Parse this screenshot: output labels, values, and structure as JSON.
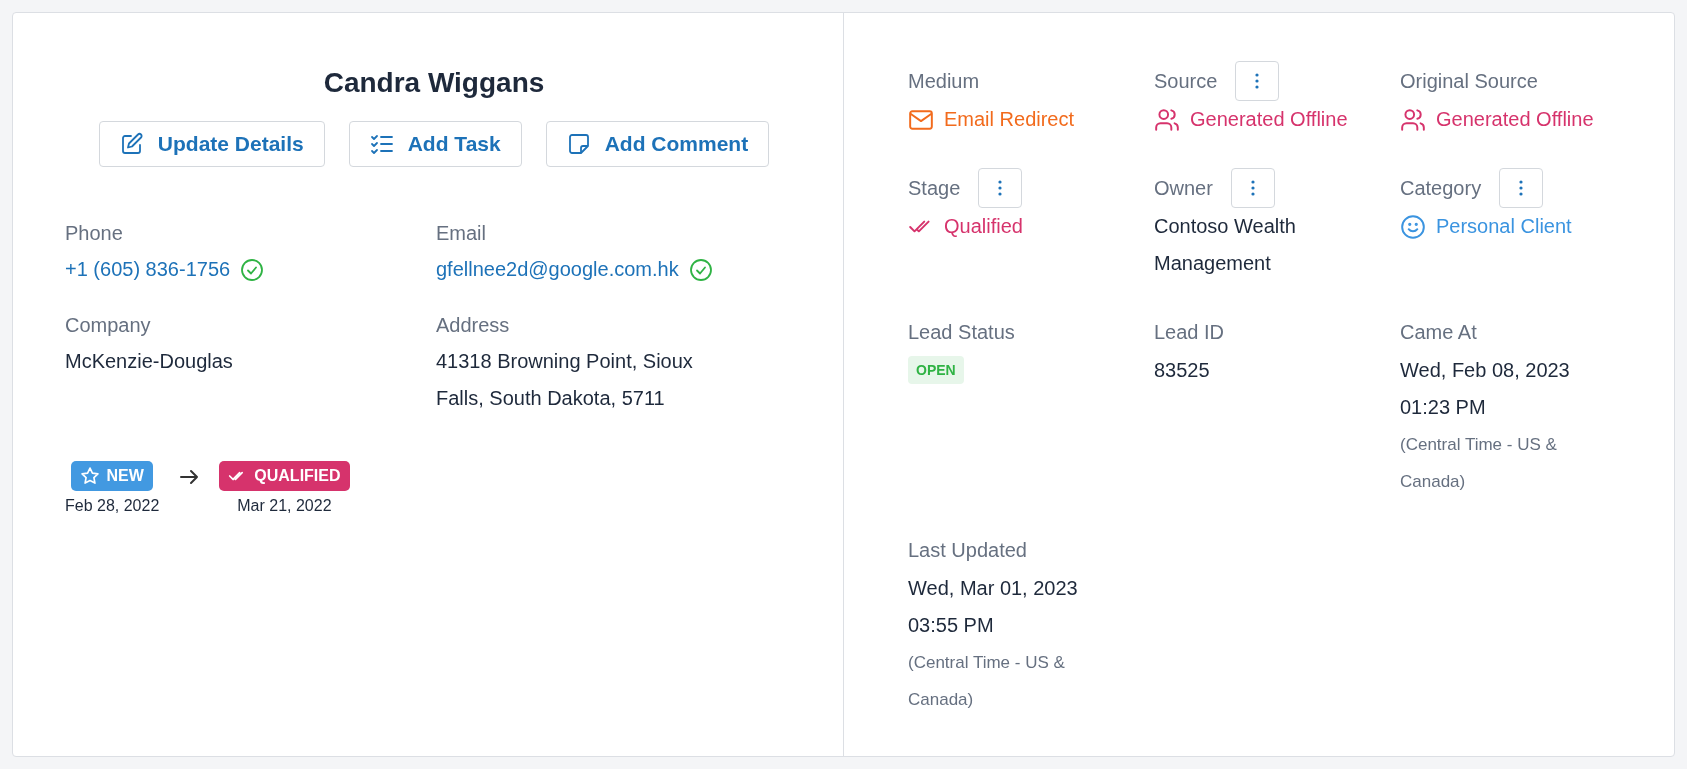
{
  "name": "Candra Wiggans",
  "actions": [
    {
      "label": "Update Details",
      "kind": "edit"
    },
    {
      "label": "Add Task",
      "kind": "tasks"
    },
    {
      "label": "Add Comment",
      "kind": "note"
    }
  ],
  "contact_fields": [
    {
      "label": "Phone",
      "value": "+1 (605) 836-1756",
      "kind": "link",
      "verified": true
    },
    {
      "label": "Email",
      "value": "gfellnee2d@google.com.hk",
      "kind": "link",
      "verified": true
    },
    {
      "label": "Company",
      "value": "McKenzie-Douglas",
      "kind": "text",
      "verified": false
    },
    {
      "label": "Address",
      "value": "41318 Browning Point, Sioux Falls, South Dakota, 5711",
      "kind": "text",
      "verified": false
    }
  ],
  "stage_history": [
    {
      "label": "NEW",
      "kind": "star",
      "color": "#4299e1",
      "date": "Feb 28, 2022"
    },
    {
      "label": "QUALIFIED",
      "kind": "checks",
      "color": "#d6336c",
      "date": "Mar 21, 2022"
    }
  ],
  "details": [
    {
      "label": "Medium",
      "menu": false,
      "kind": "mail",
      "value": "Email Redirect",
      "color": "#f26b1d"
    },
    {
      "label": "Source",
      "menu": true,
      "kind": "people",
      "value": "Generated Offline",
      "color": "#d6336c"
    },
    {
      "label": "Original Source",
      "menu": false,
      "kind": "people",
      "value": "Generated Offline",
      "color": "#d6336c"
    },
    {
      "label": "Stage",
      "menu": true,
      "kind": "checks",
      "value": "Qualified",
      "color": "#d6336c"
    },
    {
      "label": "Owner",
      "menu": true,
      "kind": "text",
      "value": "Contoso Wealth Management"
    },
    {
      "label": "Category",
      "menu": true,
      "kind": "smile",
      "value": "Personal Client",
      "color": "#3b94e0"
    },
    {
      "label": "Lead Status",
      "menu": false,
      "kind": "status",
      "value": "OPEN"
    },
    {
      "label": "Lead ID",
      "menu": false,
      "kind": "text",
      "value": "83525"
    },
    {
      "label": "Came At",
      "menu": false,
      "kind": "datetime",
      "date": "Wed, Feb 08, 2023",
      "time": "01:23 PM",
      "note": "(Central Time - US & Canada)"
    },
    {
      "label": "Last Updated",
      "menu": false,
      "kind": "datetime",
      "date": "Wed, Mar 01, 2023",
      "time": "03:55 PM",
      "note": "(Central Time - US & Canada)"
    }
  ]
}
